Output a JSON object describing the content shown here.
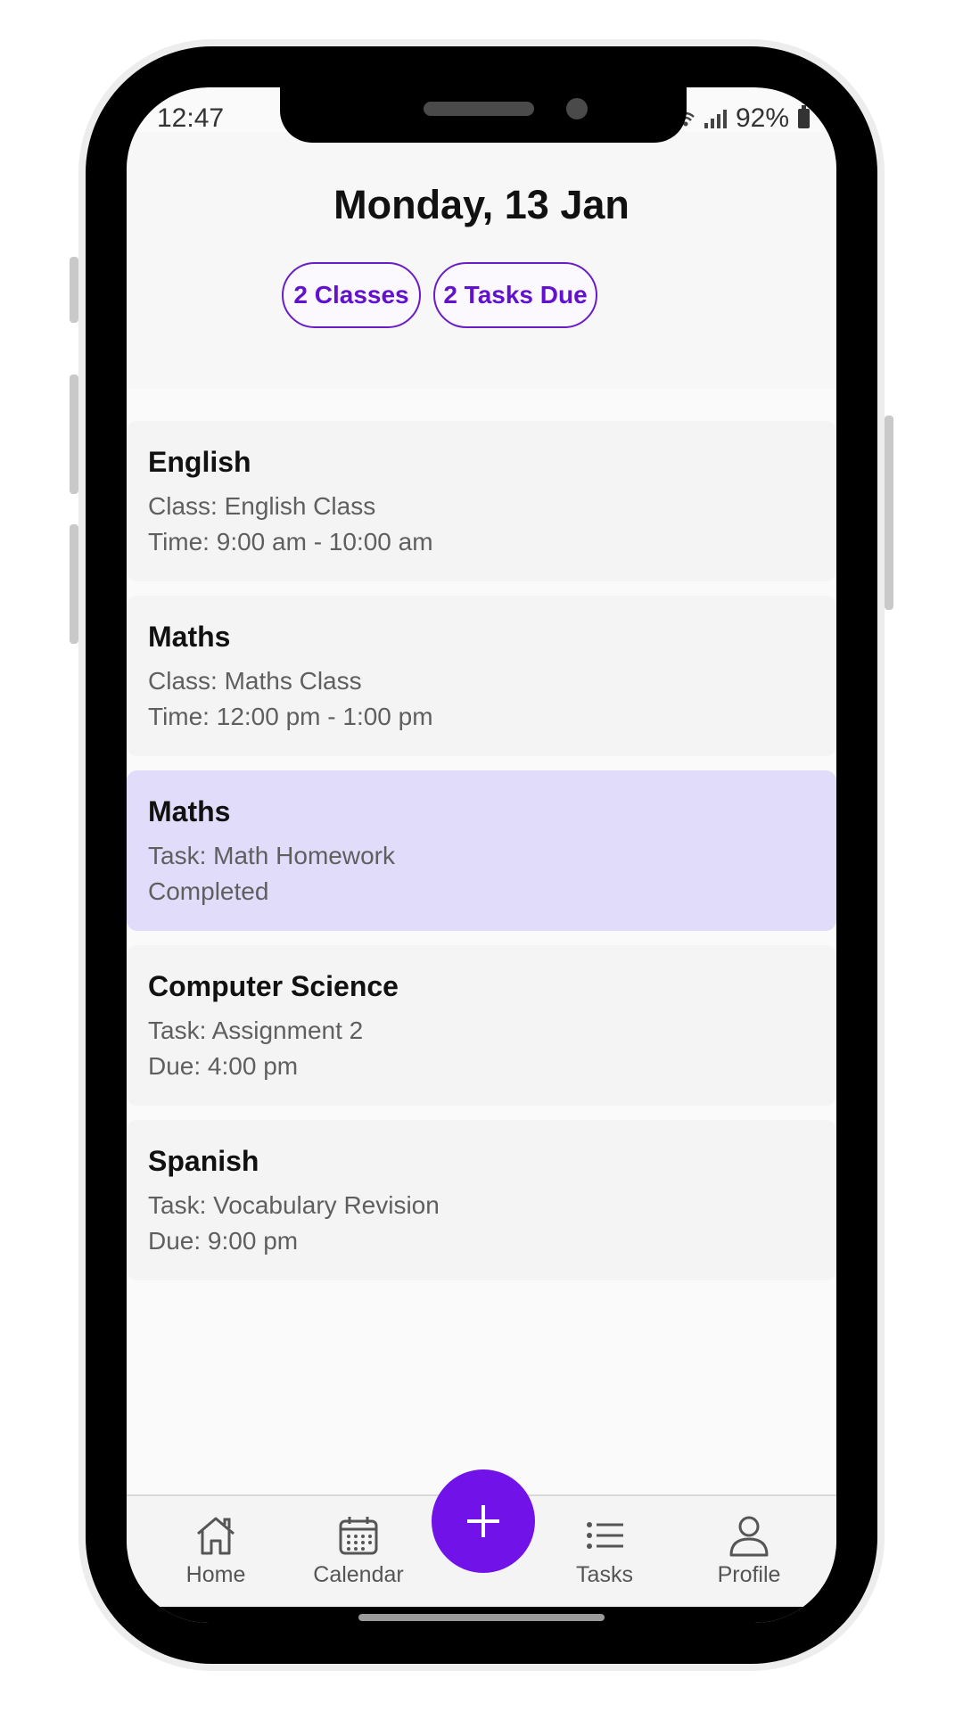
{
  "status_bar": {
    "time": "12:47",
    "battery": "92%",
    "icons": [
      "wifi-icon",
      "signal-icon",
      "battery-icon"
    ]
  },
  "header": {
    "date": "Monday, 13 Jan",
    "chips": [
      "2 Classes",
      "2 Tasks Due"
    ]
  },
  "items": [
    {
      "title": "English",
      "line1": "Class: English Class",
      "line2": "Time: 9:00 am - 10:00 am",
      "highlighted": false
    },
    {
      "title": "Maths",
      "line1": "Class: Maths Class",
      "line2": "Time: 12:00 pm - 1:00 pm",
      "highlighted": false
    },
    {
      "title": "Maths",
      "line1": "Task: Math Homework",
      "line2": "Completed",
      "highlighted": true
    },
    {
      "title": "Computer Science",
      "line1": "Task: Assignment 2",
      "line2": "Due: 4:00 pm",
      "highlighted": false
    },
    {
      "title": "Spanish",
      "line1": "Task: Vocabulary Revision",
      "line2": "Due: 9:00 pm",
      "highlighted": false
    }
  ],
  "nav": {
    "home": "Home",
    "calendar": "Calendar",
    "tasks": "Tasks",
    "profile": "Profile"
  },
  "fab_icon": "plus-icon",
  "colors": {
    "accent": "#7113e8",
    "chip_text": "#6211cf",
    "highlight_bg": "#e0dcf9",
    "card_bg": "#f4f4f4"
  }
}
